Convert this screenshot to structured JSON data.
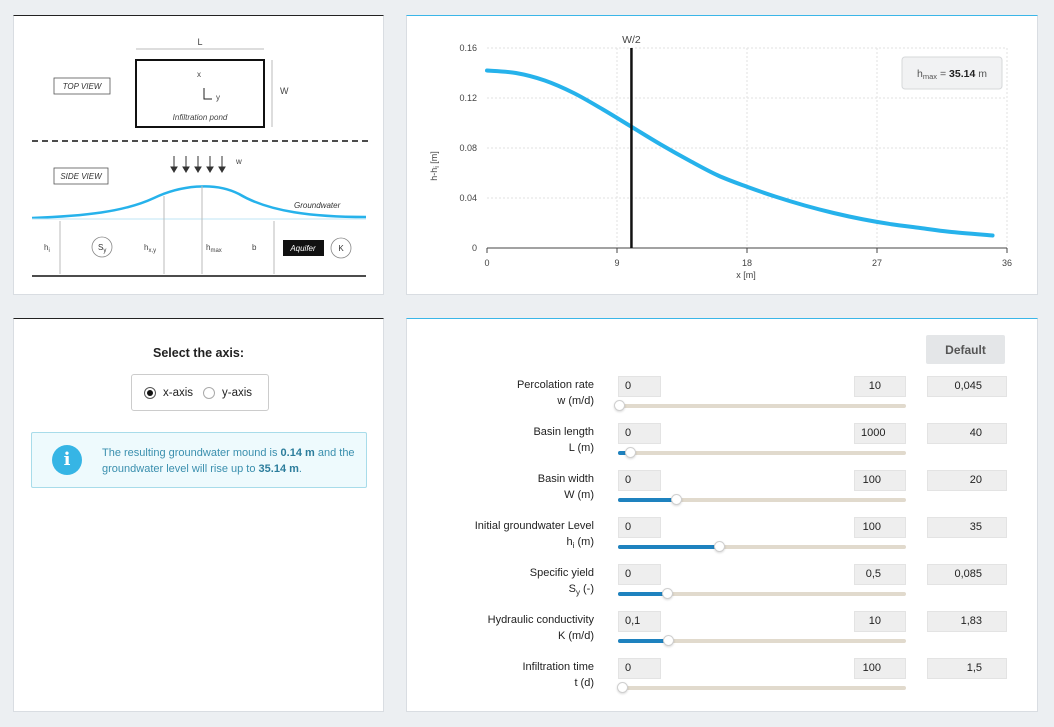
{
  "diagram": {
    "top_view": "TOP VIEW",
    "side_view": "SIDE VIEW",
    "length": "L",
    "width": "W",
    "axis_x": "x",
    "axis_y": "y",
    "pond": "Infiltration pond",
    "recharge": "w",
    "groundwater": "Groundwater",
    "hi": "h",
    "hi_sub": "i",
    "sy": "S",
    "sy_sub": "y",
    "hxy": "h",
    "hxy_sub": "x,y",
    "hmax": "h",
    "hmax_sub": "max",
    "b": "b",
    "aquifer": "Aquifer",
    "k": "K"
  },
  "chart": {
    "ylabel": "h-h",
    "ylabel_sub": "i",
    "ylabel_unit": " [m]",
    "xlabel": "x [m]",
    "marker_label": "W/2",
    "tooltip_prefix": "h",
    "tooltip_sub": "max",
    "tooltip_eq": " = ",
    "tooltip_value": "35.14",
    "tooltip_unit": " m",
    "line_color": "#26b2eb",
    "marker_x": 10,
    "y_ticks": [
      "0",
      "0.04",
      "0.08",
      "0.12",
      "0.16"
    ],
    "x_ticks": [
      "0",
      "9",
      "18",
      "27",
      "36"
    ]
  },
  "chart_data": {
    "type": "line",
    "title": "",
    "xlabel": "x [m]",
    "ylabel": "h-hi [m]",
    "xlim": [
      0,
      36
    ],
    "ylim": [
      0,
      0.16
    ],
    "x": [
      0,
      2,
      4,
      6,
      8,
      10,
      12,
      14,
      16,
      18,
      20,
      22,
      24,
      26,
      28,
      30,
      32,
      35
    ],
    "series": [
      {
        "values": [
          0.142,
          0.14,
          0.134,
          0.124,
          0.111,
          0.097,
          0.083,
          0.07,
          0.058,
          0.049,
          0.041,
          0.034,
          0.028,
          0.023,
          0.019,
          0.016,
          0.013,
          0.01
        ]
      }
    ],
    "grid": true
  },
  "axis_select": {
    "title": "Select the axis:",
    "options": [
      "x-axis",
      "y-axis"
    ],
    "selected": "x-axis"
  },
  "info": {
    "p1": "The resulting groundwater mound is ",
    "mound": "0.14 m",
    "p2": " and the groundwater level will rise up to ",
    "level": "35.14 m",
    "p3": ".",
    "icon": "info-icon"
  },
  "params": {
    "default_label": "Default",
    "rows": [
      {
        "name": "percolation-rate",
        "label1": "Percolation rate",
        "label2": "w (m/d)",
        "sub": "",
        "label2b": "",
        "min": "0",
        "max": "10",
        "value": "0,045",
        "fraction": 0.0045
      },
      {
        "name": "basin-length",
        "label1": "Basin length",
        "label2": "L (m)",
        "sub": "",
        "label2b": "",
        "min": "0",
        "max": "1000",
        "value": "40",
        "fraction": 0.04
      },
      {
        "name": "basin-width",
        "label1": "Basin width",
        "label2": "W (m)",
        "sub": "",
        "label2b": "",
        "min": "0",
        "max": "100",
        "value": "20",
        "fraction": 0.2
      },
      {
        "name": "initial-groundwater-level",
        "label1": "Initial groundwater Level",
        "label2": "h",
        "sub": "i",
        "label2b": " (m)",
        "min": "0",
        "max": "100",
        "value": "35",
        "fraction": 0.35
      },
      {
        "name": "specific-yield",
        "label1": "Specific yield",
        "label2": "S",
        "sub": "y",
        "label2b": " (-)",
        "min": "0",
        "max": "0,5",
        "value": "0,085",
        "fraction": 0.17
      },
      {
        "name": "hydraulic-conductivity",
        "label1": "Hydraulic conductivity",
        "label2": "K (m/d)",
        "sub": "",
        "label2b": "",
        "min": "0,1",
        "max": "10",
        "value": "1,83",
        "fraction": 0.175
      },
      {
        "name": "infiltration-time",
        "label1": "Infiltration time",
        "label2": "t (d)",
        "sub": "",
        "label2b": "",
        "min": "0",
        "max": "100",
        "value": "1,5",
        "fraction": 0.015
      }
    ]
  }
}
